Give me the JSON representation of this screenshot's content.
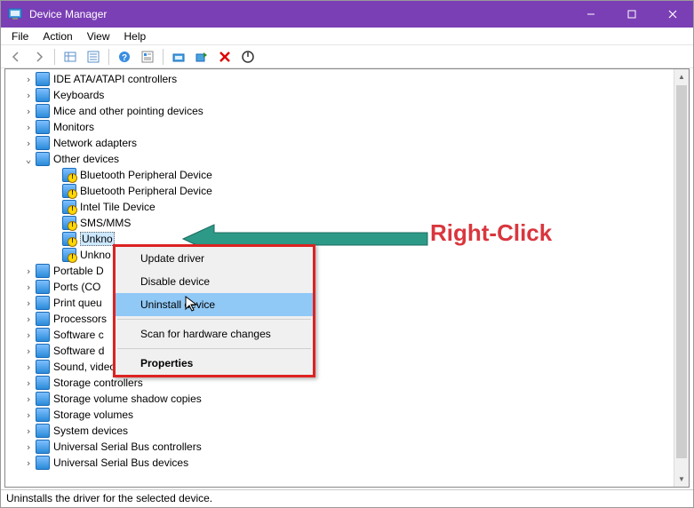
{
  "window": {
    "title": "Device Manager"
  },
  "menubar": {
    "file": "File",
    "action": "Action",
    "view": "View",
    "help": "Help"
  },
  "toolbar_icons": {
    "back": "back-icon",
    "forward": "forward-icon",
    "show_hidden": "show-hidden-icon",
    "help_topics": "help-topics-icon",
    "properties": "properties-icon",
    "update": "update-driver-icon",
    "scan": "scan-hardware-icon",
    "add_legacy": "add-legacy-icon",
    "uninstall": "uninstall-icon",
    "disable": "disable-icon"
  },
  "tree": [
    {
      "label": "IDE ATA/ATAPI controllers",
      "icon": "ide-controller-icon",
      "exp": ">",
      "level": 1
    },
    {
      "label": "Keyboards",
      "icon": "keyboard-icon",
      "exp": ">",
      "level": 1
    },
    {
      "label": "Mice and other pointing devices",
      "icon": "mouse-icon",
      "exp": ">",
      "level": 1
    },
    {
      "label": "Monitors",
      "icon": "monitor-icon",
      "exp": ">",
      "level": 1
    },
    {
      "label": "Network adapters",
      "icon": "network-adapter-icon",
      "exp": ">",
      "level": 1
    },
    {
      "label": "Other devices",
      "icon": "other-devices-icon",
      "exp": "v",
      "level": 1,
      "expanded": true
    },
    {
      "label": "Bluetooth Peripheral Device",
      "icon": "unknown-device-icon",
      "warn": true,
      "level": 2
    },
    {
      "label": "Bluetooth Peripheral Device",
      "icon": "unknown-device-icon",
      "warn": true,
      "level": 2
    },
    {
      "label": "Intel Tile Device",
      "icon": "unknown-device-icon",
      "warn": true,
      "level": 2
    },
    {
      "label": "SMS/MMS",
      "icon": "unknown-device-icon",
      "warn": true,
      "level": 2
    },
    {
      "label": "Unkno",
      "icon": "unknown-device-icon",
      "warn": true,
      "level": 2,
      "selected": true
    },
    {
      "label": "Unkno",
      "icon": "unknown-device-icon",
      "warn": true,
      "level": 2
    },
    {
      "label": "Portable D",
      "icon": "portable-devices-icon",
      "exp": ">",
      "level": 1,
      "truncated": true
    },
    {
      "label": "Ports (CO",
      "icon": "ports-icon",
      "exp": ">",
      "level": 1,
      "truncated": true
    },
    {
      "label": "Print queu",
      "icon": "print-queue-icon",
      "exp": ">",
      "level": 1,
      "truncated": true
    },
    {
      "label": "Processors",
      "icon": "processor-icon",
      "exp": ">",
      "level": 1,
      "truncated": true
    },
    {
      "label": "Software c",
      "icon": "software-component-icon",
      "exp": ">",
      "level": 1,
      "truncated": true
    },
    {
      "label": "Software d",
      "icon": "software-device-icon",
      "exp": ">",
      "level": 1,
      "truncated": true
    },
    {
      "label": "Sound, video and game controllers",
      "icon": "sound-icon",
      "exp": ">",
      "level": 1
    },
    {
      "label": "Storage controllers",
      "icon": "storage-controller-icon",
      "exp": ">",
      "level": 1
    },
    {
      "label": "Storage volume shadow copies",
      "icon": "storage-shadow-icon",
      "exp": ">",
      "level": 1
    },
    {
      "label": "Storage volumes",
      "icon": "storage-volume-icon",
      "exp": ">",
      "level": 1
    },
    {
      "label": "System devices",
      "icon": "system-devices-icon",
      "exp": ">",
      "level": 1
    },
    {
      "label": "Universal Serial Bus controllers",
      "icon": "usb-controller-icon",
      "exp": ">",
      "level": 1
    },
    {
      "label": "Universal Serial Bus devices",
      "icon": "usb-device-icon",
      "exp": ">",
      "level": 1
    }
  ],
  "context_menu": {
    "update": "Update driver",
    "disable": "Disable device",
    "uninstall": "Uninstall device",
    "scan": "Scan for hardware changes",
    "properties": "Properties",
    "highlighted": "uninstall"
  },
  "annotation": {
    "text": "Right-Click"
  },
  "statusbar": {
    "text": "Uninstalls the driver for the selected device."
  }
}
